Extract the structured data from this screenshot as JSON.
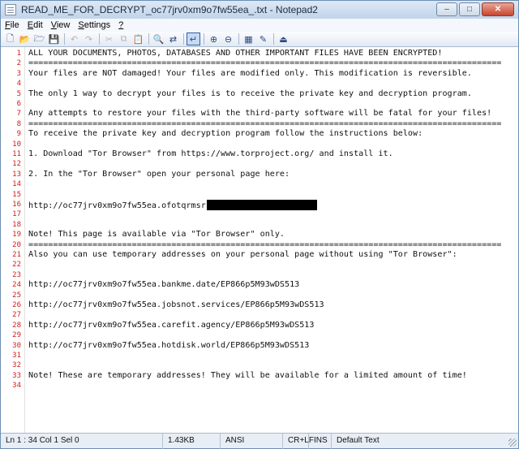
{
  "window": {
    "title": "READ_ME_FOR_DECRYPT_oc77jrv0xm9o7fw55ea_.txt - Notepad2",
    "minimize_glyph": "–",
    "maximize_glyph": "□",
    "close_glyph": "✕"
  },
  "menu": [
    {
      "accel": "F",
      "rest": "ile"
    },
    {
      "accel": "E",
      "rest": "dit"
    },
    {
      "accel": "V",
      "rest": "iew"
    },
    {
      "accel": "S",
      "rest": "ettings"
    },
    {
      "accel": "?",
      "rest": ""
    }
  ],
  "toolbar": [
    {
      "name": "new-file-icon",
      "glyph": "🗋",
      "enabled": true
    },
    {
      "name": "open-folder-icon",
      "glyph": "📂",
      "enabled": true
    },
    {
      "name": "browse-icon",
      "glyph": "🗁",
      "enabled": true
    },
    {
      "name": "save-icon",
      "glyph": "💾",
      "enabled": true
    },
    {
      "sep": true
    },
    {
      "name": "undo-icon",
      "glyph": "↶",
      "enabled": false
    },
    {
      "name": "redo-icon",
      "glyph": "↷",
      "enabled": false
    },
    {
      "sep": true
    },
    {
      "name": "cut-icon",
      "glyph": "✂",
      "enabled": false
    },
    {
      "name": "copy-icon",
      "glyph": "⧉",
      "enabled": false
    },
    {
      "name": "paste-icon",
      "glyph": "📋",
      "enabled": true
    },
    {
      "sep": true
    },
    {
      "name": "find-icon",
      "glyph": "🔍",
      "enabled": true
    },
    {
      "name": "replace-icon",
      "glyph": "⇄",
      "enabled": true
    },
    {
      "sep": true
    },
    {
      "name": "word-wrap-icon",
      "glyph": "↵",
      "enabled": true,
      "pressed": true
    },
    {
      "sep": true
    },
    {
      "name": "zoom-in-icon",
      "glyph": "⊕",
      "enabled": true
    },
    {
      "name": "zoom-out-icon",
      "glyph": "⊖",
      "enabled": true
    },
    {
      "sep": true
    },
    {
      "name": "scheme-icon",
      "glyph": "▦",
      "enabled": true
    },
    {
      "name": "customize-icon",
      "glyph": "✎",
      "enabled": true
    },
    {
      "sep": true
    },
    {
      "name": "exit-icon",
      "glyph": "⏏",
      "enabled": true
    }
  ],
  "lines": [
    {
      "n": "1",
      "text": "ALL YOUR DOCUMENTS, PHOTOS, DATABASES AND OTHER IMPORTANT FILES HAVE BEEN ENCRYPTED!"
    },
    {
      "n": "2",
      "text": "================================================================================================"
    },
    {
      "n": "3",
      "text": "Your files are NOT damaged! Your files are modified only. This modification is reversible."
    },
    {
      "n": "4",
      "text": ""
    },
    {
      "n": "5",
      "text": "The only 1 way to decrypt your files is to receive the private key and decryption program."
    },
    {
      "n": "6",
      "text": ""
    },
    {
      "n": "7",
      "text": "Any attempts to restore your files with the third-party software will be fatal for your files!"
    },
    {
      "n": "8",
      "text": "================================================================================================"
    },
    {
      "n": "9",
      "text": "To receive the private key and decryption program follow the instructions below:"
    },
    {
      "n": "10",
      "text": ""
    },
    {
      "n": "11",
      "text": "1. Download \"Tor Browser\" from https://www.torproject.org/ and install it."
    },
    {
      "n": "12",
      "text": ""
    },
    {
      "n": "13",
      "text": "2. In the \"Tor Browser\" open your personal page here:"
    },
    {
      "n": "14",
      "text": ""
    },
    {
      "n": "15",
      "text": ""
    },
    {
      "n": "16",
      "text": "http://oc77jrv0xm9o7fw55ea.ofotqrmsr",
      "redacted": true
    },
    {
      "n": "17",
      "text": ""
    },
    {
      "n": "18",
      "text": ""
    },
    {
      "n": "19",
      "text": "Note! This page is available via \"Tor Browser\" only."
    },
    {
      "n": "20",
      "text": "================================================================================================"
    },
    {
      "n": "21",
      "text": "Also you can use temporary addresses on your personal page without using \"Tor Browser\":"
    },
    {
      "n": "22",
      "text": ""
    },
    {
      "n": "23",
      "text": ""
    },
    {
      "n": "24",
      "text": "http://oc77jrv0xm9o7fw55ea.bankme.date/EP866p5M93wDS513"
    },
    {
      "n": "25",
      "text": ""
    },
    {
      "n": "26",
      "text": "http://oc77jrv0xm9o7fw55ea.jobsnot.services/EP866p5M93wDS513"
    },
    {
      "n": "27",
      "text": ""
    },
    {
      "n": "28",
      "text": "http://oc77jrv0xm9o7fw55ea.carefit.agency/EP866p5M93wDS513"
    },
    {
      "n": "29",
      "text": ""
    },
    {
      "n": "30",
      "text": "http://oc77jrv0xm9o7fw55ea.hotdisk.world/EP866p5M93wDS513"
    },
    {
      "n": "31",
      "text": ""
    },
    {
      "n": "32",
      "text": ""
    },
    {
      "n": "33",
      "text": "Note! These are temporary addresses! They will be available for a limited amount of time!"
    },
    {
      "n": "34",
      "text": ""
    }
  ],
  "status": {
    "position": "Ln 1 : 34   Col 1   Sel 0",
    "size": "1.43KB",
    "encoding": "ANSI",
    "line_endings": "CR+LF",
    "mode": "INS",
    "scheme": "Default Text"
  }
}
